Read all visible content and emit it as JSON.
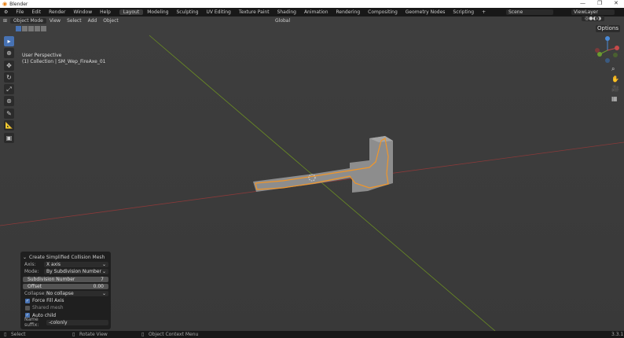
{
  "window": {
    "title": "Blender",
    "minimize": "—",
    "maximize": "❐",
    "close": "✕"
  },
  "menu": [
    "File",
    "Edit",
    "Render",
    "Window",
    "Help"
  ],
  "workspaces": [
    "Layout",
    "Modeling",
    "Sculpting",
    "UV Editing",
    "Texture Paint",
    "Shading",
    "Animation",
    "Rendering",
    "Compositing",
    "Geometry Nodes",
    "Scripting"
  ],
  "add_workspace": "+",
  "scene": "Scene",
  "view_layer": "ViewLayer",
  "header": {
    "mode": "Object Mode",
    "menus": [
      "View",
      "Select",
      "Add",
      "Object"
    ],
    "orientation": "Global",
    "options": "Options"
  },
  "viewport": {
    "perspective": "User Perspective",
    "collection": "(1) Collection | SM_Wep_FireAxe_01"
  },
  "gizmo": {
    "z": "Z",
    "y": "Y",
    "x": "X"
  },
  "panel": {
    "title": "Create Simplified Collision Mesh",
    "axis_label": "Axis:",
    "axis": "X axis",
    "mode_label": "Mode:",
    "mode": "By Subdivision Number",
    "subdiv_label": "Subdivision Number",
    "subdiv": "7",
    "offset_label": "Offset",
    "offset": "0.00",
    "collapse_label": "Collapse:",
    "collapse": "No collapse",
    "force_fill": "Force Fill Axis",
    "force_fill_checked": true,
    "shared_mesh": "Shared mesh",
    "shared_mesh_checked": false,
    "auto_child": "Auto child",
    "auto_child_checked": true,
    "suffix_label": "Name suffix:",
    "suffix": "-colonly"
  },
  "status": {
    "select": "Select",
    "rotate": "Rotate View",
    "context": "Object Context Menu",
    "version": "3.3.1"
  },
  "colors": {
    "accent": "#4772b3",
    "selection": "#f0962a",
    "x_axis": "#9a3a3a",
    "y_axis": "#6b8e23"
  }
}
